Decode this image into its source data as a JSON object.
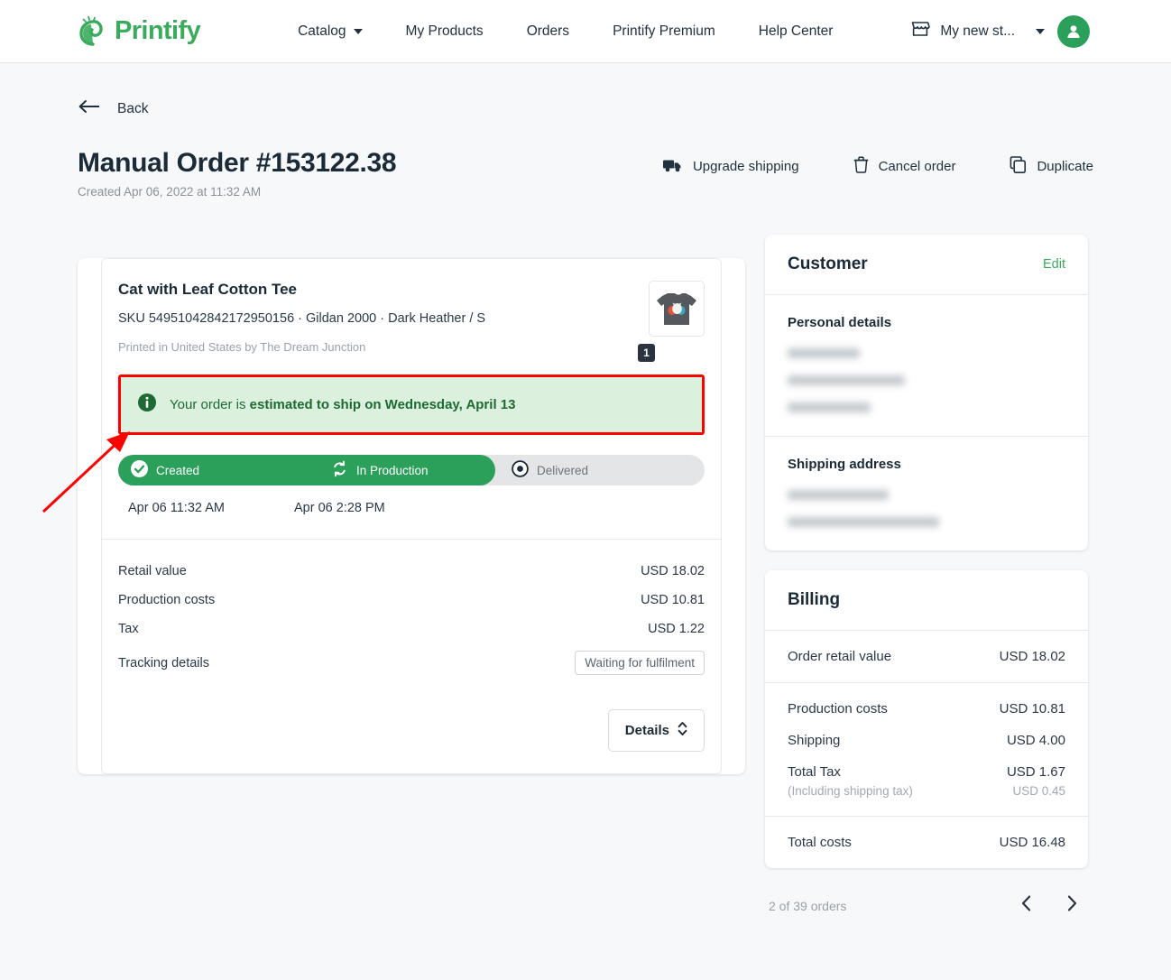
{
  "nav": {
    "brand": "Printify",
    "links": [
      {
        "label": "Catalog",
        "has_caret": true
      },
      {
        "label": "My Products",
        "has_caret": false
      },
      {
        "label": "Orders",
        "has_caret": false
      },
      {
        "label": "Printify Premium",
        "has_caret": false
      },
      {
        "label": "Help Center",
        "has_caret": false
      }
    ],
    "store": "My new st...",
    "icons": {
      "store": "store-icon",
      "caret": "chevron-down-icon",
      "avatar": "user-avatar-icon"
    }
  },
  "header": {
    "back": "Back",
    "title": "Manual Order #153122.38",
    "subtitle": "Created Apr 06, 2022 at 11:32 AM",
    "actions": [
      {
        "label": "Upgrade shipping",
        "icon": "truck-icon"
      },
      {
        "label": "Cancel order",
        "icon": "trash-icon"
      },
      {
        "label": "Duplicate",
        "icon": "copy-icon"
      }
    ]
  },
  "product": {
    "title": "Cat with Leaf Cotton Tee",
    "sku": "SKU 54951042842172950156  · Gildan 2000 · Dark Heather / S",
    "printed_by": "Printed in United States by The Dream Junction",
    "quantity": "1"
  },
  "banner": {
    "icon": "info-icon",
    "prefix": "Your order is ",
    "highlight": "estimated to ship on Wednesday, April 13",
    "background": "#dcf0de",
    "text_color": "#1d6b33",
    "annotation_color": "#ff0000"
  },
  "status": {
    "steps": [
      {
        "label": "Created",
        "state": "done",
        "icon": "check-circle-icon",
        "time": "Apr 06 11:32 AM"
      },
      {
        "label": "In Production",
        "state": "current",
        "icon": "sync-icon",
        "time": "Apr 06 2:28 PM"
      },
      {
        "label": "Delivered",
        "state": "pending",
        "icon": "target-dot-icon",
        "time": ""
      }
    ],
    "active_color": "#2aa05a",
    "inactive_color": "#e3e5e7"
  },
  "pricing": {
    "rows": [
      {
        "label": "Retail value",
        "value": "USD 18.02"
      },
      {
        "label": "Production costs",
        "value": "USD 10.81"
      },
      {
        "label": "Tax",
        "value": "USD 1.22"
      }
    ],
    "tracking_label": "Tracking details",
    "tracking_badge": "Waiting for fulfilment",
    "details_button": "Details",
    "details_icon": "chevron-up-down-icon"
  },
  "customer": {
    "title": "Customer",
    "edit": "Edit",
    "personal_title": "Personal details",
    "personal_redacted_lines": 3,
    "shipping_title": "Shipping address",
    "shipping_redacted_lines": 2
  },
  "billing": {
    "title": "Billing",
    "order_retail": {
      "label": "Order retail value",
      "value": "USD 18.02"
    },
    "rows": [
      {
        "label": "Production costs",
        "value": "USD 10.81"
      },
      {
        "label": "Shipping",
        "value": "USD 4.00"
      },
      {
        "label": "Total Tax",
        "value": "USD 1.67",
        "sub_label": "(Including shipping tax)",
        "sub_value": "USD 0.45"
      }
    ],
    "total": {
      "label": "Total costs",
      "value": "USD 16.48"
    }
  },
  "pager": {
    "text": "2 of 39 orders",
    "prev_icon": "chevron-left-icon",
    "next_icon": "chevron-right-icon"
  }
}
